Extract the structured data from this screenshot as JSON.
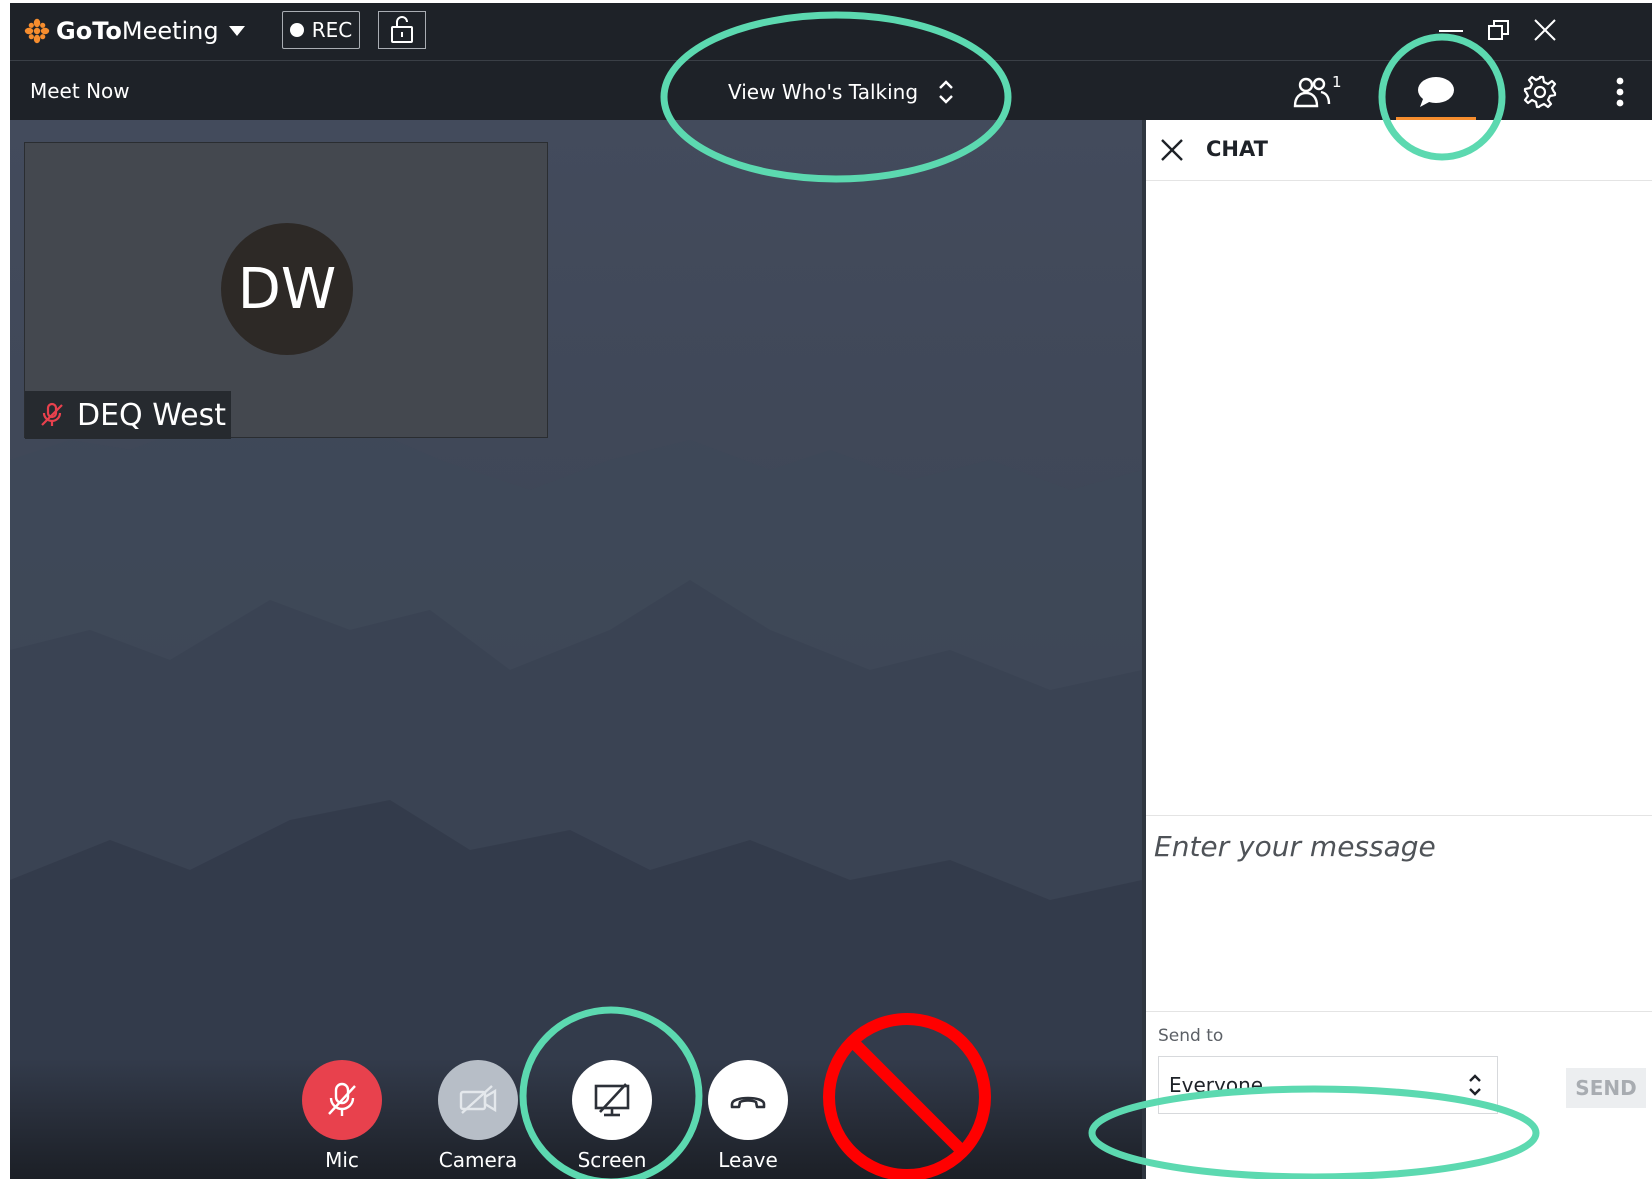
{
  "app": {
    "brand_bold": "GoTo",
    "brand_light": "Meeting",
    "rec_label": "REC"
  },
  "toolbar": {
    "meeting_name": "Meet Now",
    "view_mode": "View Who's Talking",
    "attendee_count": "1"
  },
  "stage": {
    "participant": {
      "initials": "DW",
      "name": "DEQ West",
      "muted": true
    },
    "controls": [
      {
        "label": "Mic",
        "state": "muted",
        "color": "#e8414d"
      },
      {
        "label": "Camera",
        "state": "off",
        "color": "#b7bec7"
      },
      {
        "label": "Screen",
        "state": "off",
        "color": "#ffffff"
      },
      {
        "label": "Leave",
        "state": "normal",
        "color": "#ffffff"
      }
    ]
  },
  "chat": {
    "title": "CHAT",
    "message_placeholder": "Enter your message",
    "send_to_label": "Send to",
    "send_to_value": "Everyone",
    "send_label": "SEND"
  },
  "colors": {
    "accent": "#f68d2e",
    "annotation_circle": "#5cd9b0",
    "prohibited": "#ff0000"
  }
}
